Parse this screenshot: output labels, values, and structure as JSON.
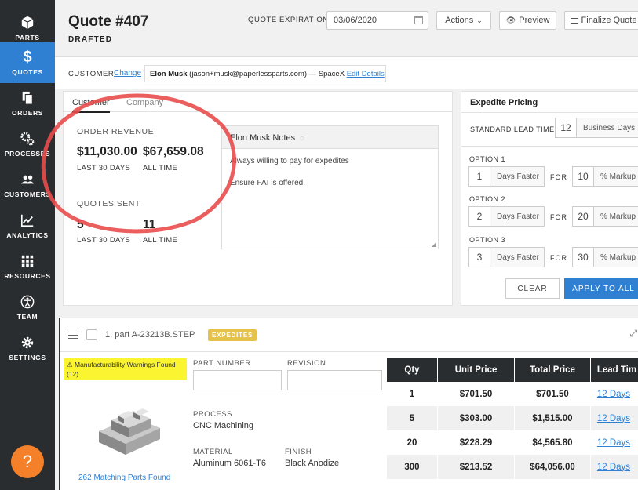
{
  "sidebar": {
    "items": [
      {
        "label": "PARTS",
        "icon": "cube-icon"
      },
      {
        "label": "QUOTES",
        "icon": "dollar-icon"
      },
      {
        "label": "ORDERS",
        "icon": "documents-icon"
      },
      {
        "label": "PROCESSES",
        "icon": "gears-icon"
      },
      {
        "label": "CUSTOMERS",
        "icon": "people-icon"
      },
      {
        "label": "ANALYTICS",
        "icon": "line-chart-icon"
      },
      {
        "label": "RESOURCES",
        "icon": "grid-icon"
      },
      {
        "label": "TEAM",
        "icon": "accessibility-icon"
      },
      {
        "label": "SETTINGS",
        "icon": "gear-icon"
      }
    ],
    "active": "QUOTES",
    "help_label": "?"
  },
  "header": {
    "title": "Quote #407",
    "status": "DRAFTED",
    "expiration_label": "QUOTE EXPIRATION",
    "expiration_value": "03/06/2020",
    "actions_label": "Actions",
    "preview_label": "Preview",
    "finalize_label": "Finalize Quote"
  },
  "customer_bar": {
    "label": "CUSTOMER",
    "change_link": "Change",
    "customer_name": "Elon Musk",
    "customer_email": "(jason+musk@paperlessparts.com)",
    "customer_company": "— SpaceX",
    "edit_link": "Edit Details"
  },
  "customer_panel": {
    "tabs": [
      "Customer",
      "Company"
    ],
    "active_tab": "Customer",
    "order_revenue": {
      "heading": "ORDER REVENUE",
      "recent_value": "$11,030.00",
      "recent_label": "LAST 30 DAYS",
      "all_value": "$67,659.08",
      "all_label": "ALL TIME"
    },
    "quotes_sent": {
      "heading": "QUOTES SENT",
      "recent_value": "5",
      "recent_label": "LAST 30 DAYS",
      "all_value": "11",
      "all_label": "ALL TIME"
    },
    "notes": {
      "title": "Elon Musk Notes",
      "lines": [
        "Always willing to pay for expedites",
        "Ensure FAI is offered."
      ]
    }
  },
  "expedite": {
    "title": "Expedite Pricing",
    "standard_label": "STANDARD LEAD TIME",
    "standard_value": "12",
    "standard_unit": "Business Days",
    "for_label": "FOR",
    "days_unit": "Days Faster",
    "markup_unit": "% Markup",
    "options": [
      {
        "label": "OPTION 1",
        "days": "1",
        "markup": "10"
      },
      {
        "label": "OPTION 2",
        "days": "2",
        "markup": "20"
      },
      {
        "label": "OPTION 3",
        "days": "3",
        "markup": "30"
      }
    ],
    "clear_label": "CLEAR",
    "apply_label": "APPLY TO ALL"
  },
  "part": {
    "name": "1. part A-23213B.STEP",
    "badge": "EXPEDITES",
    "warning": "Manufacturability Warnings Found (12)",
    "part_number_label": "PART NUMBER",
    "part_number_value": "",
    "revision_label": "REVISION",
    "revision_value": "",
    "process_label": "PROCESS",
    "process_value": "CNC Machining",
    "material_label": "MATERIAL",
    "material_value": "Aluminum 6061-T6",
    "finish_label": "FINISH",
    "finish_value": "Black Anodize",
    "matching_link": "262 Matching Parts Found"
  },
  "pricing_table": {
    "headers": [
      "Qty",
      "Unit Price",
      "Total Price",
      "Lead Tim"
    ],
    "rows": [
      {
        "qty": "1",
        "unit": "$701.50",
        "total": "$701.50",
        "lead": "12 Days"
      },
      {
        "qty": "5",
        "unit": "$303.00",
        "total": "$1,515.00",
        "lead": "12 Days"
      },
      {
        "qty": "20",
        "unit": "$228.29",
        "total": "$4,565.80",
        "lead": "12 Days"
      },
      {
        "qty": "300",
        "unit": "$213.52",
        "total": "$64,056.00",
        "lead": "12 Days"
      }
    ]
  },
  "colors": {
    "sidebar": "#2a2d30",
    "accent": "#2f80d3",
    "badge": "#e6c24a",
    "warning": "#fbf431",
    "help": "#f4812a",
    "annotation": "#e84c4c"
  }
}
